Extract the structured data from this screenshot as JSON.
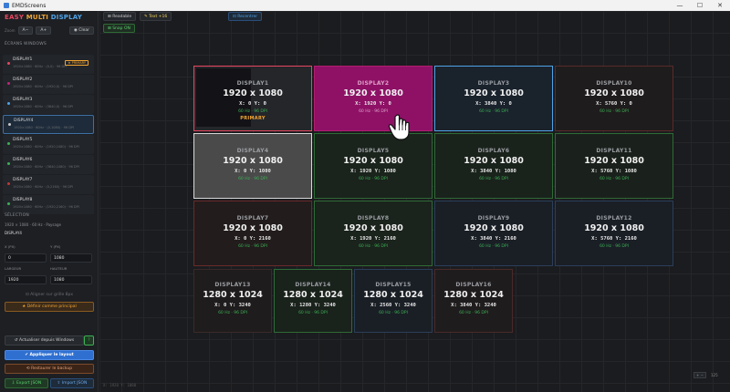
{
  "window": {
    "title": "EMDScreens",
    "minimize": "—",
    "maximize": "☐",
    "close": "✕"
  },
  "brand": {
    "part1": "EASY",
    "part2": "MULTI",
    "part3": "DISPLAY"
  },
  "zoom": {
    "label": "Zoom",
    "minus": "A−",
    "plus": "A+",
    "clear": "◉ Clear"
  },
  "sections": {
    "screens": "ÉCRANS WINDOWS",
    "selection": "SÉLECTION"
  },
  "screens": [
    {
      "name": "DISPLAY1",
      "sub": "1920×1080 · 60Hz · (0,0) · 96 DPI",
      "color": "#e8475f",
      "badge": "★ PRIMARY"
    },
    {
      "name": "DISPLAY2",
      "sub": "1920×1080 · 60Hz · (1920,0) · 96 DPI",
      "color": "#c0267a",
      "badge": ""
    },
    {
      "name": "DISPLAY3",
      "sub": "1920×1080 · 60Hz · (3840,0) · 96 DPI",
      "color": "#4fa3e8",
      "badge": ""
    },
    {
      "name": "DISPLAY4",
      "sub": "1920×1080 · 60Hz · (0,1080) · 96 DPI",
      "color": "#c8c8c8",
      "badge": ""
    },
    {
      "name": "DISPLAY5",
      "sub": "1920×1080 · 60Hz · (1920,1080) · 96 DPI",
      "color": "#3cb054",
      "badge": ""
    },
    {
      "name": "DISPLAY6",
      "sub": "1920×1080 · 60Hz · (3840,1080) · 96 DPI",
      "color": "#3cb054",
      "badge": ""
    },
    {
      "name": "DISPLAY7",
      "sub": "1920×1080 · 60Hz · (0,2160) · 96 DPI",
      "color": "#c03838",
      "badge": ""
    },
    {
      "name": "DISPLAY8",
      "sub": "1920×1080 · 60Hz · (1920,2160) · 96 DPI",
      "color": "#3cb054",
      "badge": ""
    }
  ],
  "selection": {
    "info": "1920 × 1080 · 60 Hz · Paysage",
    "name": "DISPLAY4",
    "x_label": "X (PX)",
    "y_label": "Y (PX)",
    "x_value": "0",
    "y_value": "1080",
    "w_label": "LARGEUR",
    "h_label": "HAUTEUR",
    "w_value": "1920",
    "h_value": "1080",
    "align_label": "⊡ Aligner sur grille 8px",
    "set_primary": "★ Définir comme principal"
  },
  "actions": {
    "refresh": "↺ Actualiser depuis Windows",
    "help": "?",
    "apply": "✔ Appliquer le layout",
    "restore": "⟲ Restaurer le backup",
    "export": "⇩ Export JSON",
    "import": "⇧ Import JSON"
  },
  "toolbar": {
    "readable": "⊞ Readable",
    "text_size": "✎ Text +16",
    "recenter": "⊡ Recentrer",
    "snap": "⊞ Snap ON"
  },
  "monitors": [
    {
      "name": "DISPLAY1",
      "res": "1920 x 1080",
      "pos": "X: 0 Y: 0",
      "hz": "60 Hz · 96 DPI",
      "primary": "PRIMARY",
      "border": "#e8475f",
      "bg": "#24262a"
    },
    {
      "name": "DISPLAY2",
      "res": "1920 x 1080",
      "pos": "X: 1920 Y: 0",
      "hz": "60 Hz · 96 DPI",
      "primary": "",
      "border": "#b01e6e",
      "bg": "#8e1166"
    },
    {
      "name": "DISPLAY3",
      "res": "1920 x 1080",
      "pos": "X: 3840 Y: 0",
      "hz": "60 Hz · 96 DPI",
      "primary": "",
      "border": "#4fa3e8",
      "bg": "#1a222c"
    },
    {
      "name": "DISPLAY10",
      "res": "1920 x 1080",
      "pos": "X: 5760 Y: 0",
      "hz": "60 Hz · 96 DPI",
      "primary": "",
      "border": "#5a2a2a",
      "bg": "#1f1c1d"
    },
    {
      "name": "DISPLAY4",
      "res": "1920 x 1080",
      "pos": "X: 0 Y: 1080",
      "hz": "60 Hz · 96 DPI",
      "primary": "",
      "border": "#d8d8d8",
      "bg": "#4a4a4a"
    },
    {
      "name": "DISPLAY5",
      "res": "1920 x 1080",
      "pos": "X: 1920 Y: 1080",
      "hz": "60 Hz · 96 DPI",
      "primary": "",
      "border": "#2e6b35",
      "bg": "#1a231c"
    },
    {
      "name": "DISPLAY6",
      "res": "1920 x 1080",
      "pos": "X: 3840 Y: 1080",
      "hz": "60 Hz · 96 DPI",
      "primary": "",
      "border": "#2e6b35",
      "bg": "#1a221c"
    },
    {
      "name": "DISPLAY11",
      "res": "1920 x 1080",
      "pos": "X: 5760 Y: 1080",
      "hz": "60 Hz · 96 DPI",
      "primary": "",
      "border": "#2e6b35",
      "bg": "#1a211c"
    },
    {
      "name": "DISPLAY7",
      "res": "1920 x 1080",
      "pos": "X: 0 Y: 2160",
      "hz": "60 Hz · 96 DPI",
      "primary": "",
      "border": "#6b2a2a",
      "bg": "#221c1c"
    },
    {
      "name": "DISPLAY8",
      "res": "1920 x 1080",
      "pos": "X: 1920 Y: 2160",
      "hz": "60 Hz · 96 DPI",
      "primary": "",
      "border": "#2e6b35",
      "bg": "#1a231c"
    },
    {
      "name": "DISPLAY9",
      "res": "1920 x 1080",
      "pos": "X: 3840 Y: 2160",
      "hz": "60 Hz · 96 DPI",
      "primary": "",
      "border": "#2a3e5a",
      "bg": "#1a1f26"
    },
    {
      "name": "DISPLAY12",
      "res": "1920 x 1080",
      "pos": "X: 5760 Y: 2160",
      "hz": "60 Hz · 96 DPI",
      "primary": "",
      "border": "#2a3e5a",
      "bg": "#1a1f26"
    },
    {
      "name": "DISPLAY13",
      "res": "1280 x 1024",
      "pos": "X: 0 Y: 3240",
      "hz": "60 Hz · 96 DPI",
      "primary": "",
      "border": "#3a2a2a",
      "bg": "#1f1c1d"
    },
    {
      "name": "DISPLAY14",
      "res": "1280 x 1024",
      "pos": "X: 1280 Y: 3240",
      "hz": "60 Hz · 96 DPI",
      "primary": "",
      "border": "#2e6b35",
      "bg": "#1a221c"
    },
    {
      "name": "DISPLAY15",
      "res": "1280 x 1024",
      "pos": "X: 2560 Y: 3240",
      "hz": "60 Hz · 96 DPI",
      "primary": "",
      "border": "#2a3e5a",
      "bg": "#1a1f26"
    },
    {
      "name": "DISPLAY16",
      "res": "1280 x 1024",
      "pos": "X: 3840 Y: 3240",
      "hz": "60 Hz · 96 DPI",
      "primary": "",
      "border": "#4a2a2a",
      "bg": "#1f1c1d"
    }
  ],
  "status": {
    "coords": "X: 1920 Y: 1080",
    "zoom": "125"
  }
}
